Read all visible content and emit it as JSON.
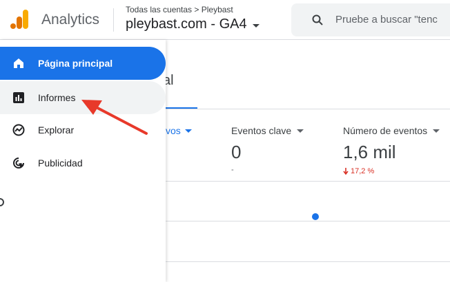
{
  "header": {
    "app_name": "Analytics",
    "breadcrumb": "Todas las cuentas > Pleybast",
    "property_name": "pleybast.com - GA4",
    "search_placeholder": "Pruebe a buscar \"tenc"
  },
  "sidebar": {
    "items": [
      {
        "label": "Página principal",
        "icon": "home-icon",
        "active": true
      },
      {
        "label": "Informes",
        "icon": "reports-icon",
        "active": false
      },
      {
        "label": "Explorar",
        "icon": "explore-icon",
        "active": false
      },
      {
        "label": "Publicidad",
        "icon": "advertising-icon",
        "active": false
      }
    ]
  },
  "main": {
    "title_partial": "al",
    "metrics": [
      {
        "label": "vos",
        "partial": true
      },
      {
        "label": "Eventos clave",
        "value": "0",
        "sub": "-"
      },
      {
        "label": "Número de eventos",
        "value": "1,6 mil",
        "change": "17,2 %"
      }
    ]
  },
  "colors": {
    "accent": "#1a73e8",
    "negative": "#d93025",
    "annotation_arrow": "#e8392a",
    "logo_orange": "#f9ab00",
    "logo_dark_orange": "#e37400"
  }
}
